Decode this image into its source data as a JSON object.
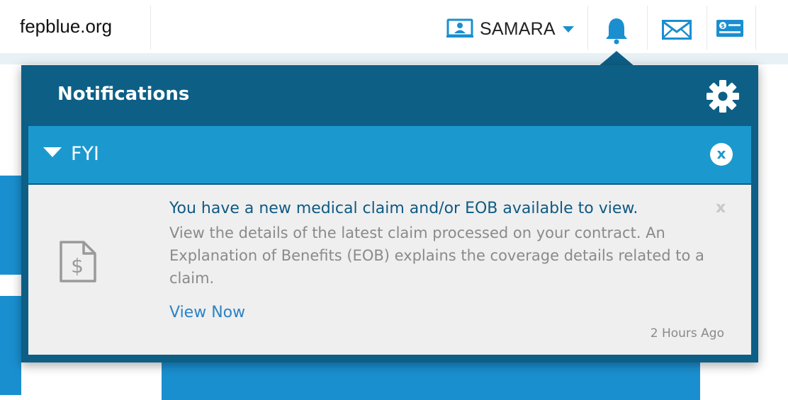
{
  "header": {
    "site_name": "fepblue.org",
    "user_name": "SAMARA",
    "icons": {
      "profile": "id-card-icon",
      "user_menu_caret": "caret-down-icon",
      "notifications": "bell-icon",
      "messages": "envelope-icon",
      "payments": "payment-card-icon"
    }
  },
  "notifications": {
    "title": "Notifications",
    "settings_icon": "gear-icon",
    "group": {
      "label": "FYI",
      "close_label": "x",
      "items": [
        {
          "icon": "claim-document-icon",
          "title": "You have a new medical claim and/or EOB available to view.",
          "body": "View the details of the latest claim processed on your contract. An Explanation of Benefits (EOB) explains the coverage details related to a claim.",
          "link_label": "View Now",
          "timestamp": "2 Hours Ago",
          "dismiss_label": "x"
        }
      ]
    }
  },
  "colors": {
    "brand_blue": "#1a8fd0",
    "panel_navy": "#0d5f86",
    "group_blue": "#1b99cf",
    "link_blue": "#2b83c6"
  }
}
